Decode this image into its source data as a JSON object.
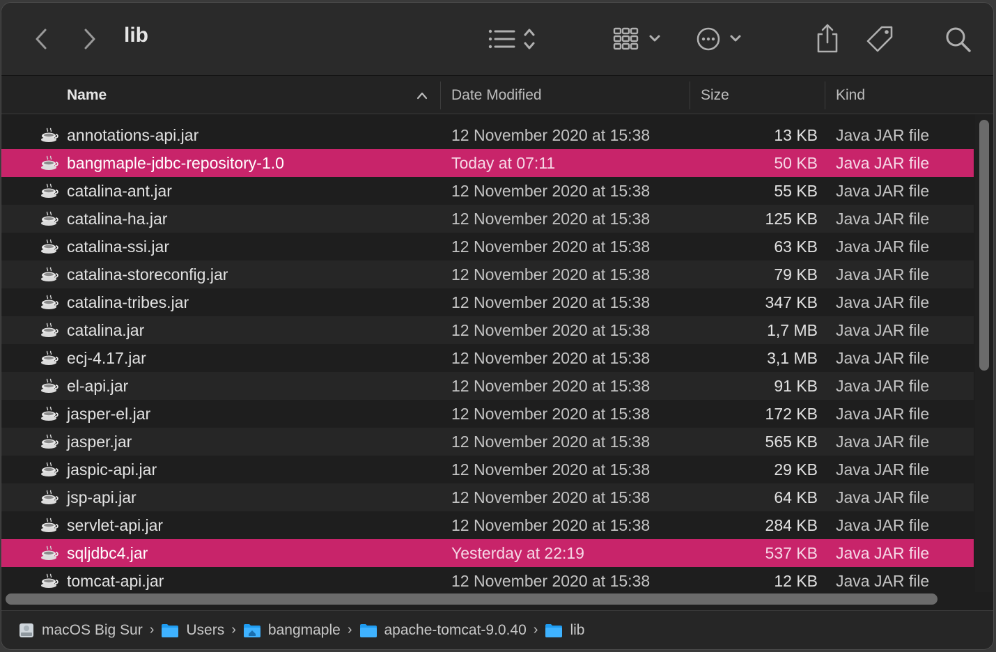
{
  "window": {
    "title": "lib"
  },
  "columns": {
    "name": "Name",
    "date": "Date Modified",
    "size": "Size",
    "kind": "Kind"
  },
  "files": [
    {
      "name": "annotations-api.jar",
      "date": "12 November 2020 at 15:38",
      "size": "13 KB",
      "kind": "Java JAR file",
      "selected": false
    },
    {
      "name": "bangmaple-jdbc-repository-1.0",
      "date": "Today at 07:11",
      "size": "50 KB",
      "kind": "Java JAR file",
      "selected": true
    },
    {
      "name": "catalina-ant.jar",
      "date": "12 November 2020 at 15:38",
      "size": "55 KB",
      "kind": "Java JAR file",
      "selected": false
    },
    {
      "name": "catalina-ha.jar",
      "date": "12 November 2020 at 15:38",
      "size": "125 KB",
      "kind": "Java JAR file",
      "selected": false
    },
    {
      "name": "catalina-ssi.jar",
      "date": "12 November 2020 at 15:38",
      "size": "63 KB",
      "kind": "Java JAR file",
      "selected": false
    },
    {
      "name": "catalina-storeconfig.jar",
      "date": "12 November 2020 at 15:38",
      "size": "79 KB",
      "kind": "Java JAR file",
      "selected": false
    },
    {
      "name": "catalina-tribes.jar",
      "date": "12 November 2020 at 15:38",
      "size": "347 KB",
      "kind": "Java JAR file",
      "selected": false
    },
    {
      "name": "catalina.jar",
      "date": "12 November 2020 at 15:38",
      "size": "1,7 MB",
      "kind": "Java JAR file",
      "selected": false
    },
    {
      "name": "ecj-4.17.jar",
      "date": "12 November 2020 at 15:38",
      "size": "3,1 MB",
      "kind": "Java JAR file",
      "selected": false
    },
    {
      "name": "el-api.jar",
      "date": "12 November 2020 at 15:38",
      "size": "91 KB",
      "kind": "Java JAR file",
      "selected": false
    },
    {
      "name": "jasper-el.jar",
      "date": "12 November 2020 at 15:38",
      "size": "172 KB",
      "kind": "Java JAR file",
      "selected": false
    },
    {
      "name": "jasper.jar",
      "date": "12 November 2020 at 15:38",
      "size": "565 KB",
      "kind": "Java JAR file",
      "selected": false
    },
    {
      "name": "jaspic-api.jar",
      "date": "12 November 2020 at 15:38",
      "size": "29 KB",
      "kind": "Java JAR file",
      "selected": false
    },
    {
      "name": "jsp-api.jar",
      "date": "12 November 2020 at 15:38",
      "size": "64 KB",
      "kind": "Java JAR file",
      "selected": false
    },
    {
      "name": "servlet-api.jar",
      "date": "12 November 2020 at 15:38",
      "size": "284 KB",
      "kind": "Java JAR file",
      "selected": false
    },
    {
      "name": "sqljdbc4.jar",
      "date": "Yesterday at 22:19",
      "size": "537 KB",
      "kind": "Java JAR file",
      "selected": true
    },
    {
      "name": "tomcat-api.jar",
      "date": "12 November 2020 at 15:38",
      "size": "12 KB",
      "kind": "Java JAR file",
      "selected": false
    }
  ],
  "pathbar": [
    {
      "label": "macOS Big Sur",
      "icon": "disk-icon"
    },
    {
      "label": "Users",
      "icon": "folder-icon"
    },
    {
      "label": "bangmaple",
      "icon": "home-folder-icon"
    },
    {
      "label": "apache-tomcat-9.0.40",
      "icon": "folder-icon"
    },
    {
      "label": "lib",
      "icon": "folder-icon"
    }
  ],
  "colors": {
    "selection": "#c8246a",
    "folder": "#1e9bf0"
  }
}
